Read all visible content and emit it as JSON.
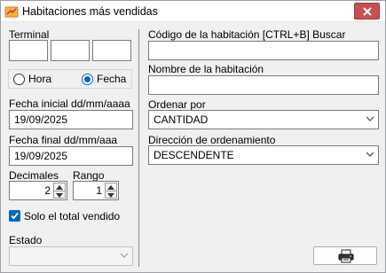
{
  "window": {
    "title": "Habitaciones más vendidas"
  },
  "terminal": {
    "label": "Terminal",
    "values": [
      "",
      "",
      ""
    ]
  },
  "mode": {
    "options": [
      "Hora",
      "Fecha"
    ],
    "selected": "Fecha"
  },
  "fecha_inicial": {
    "label": "Fecha inicial dd/mm/aaaa",
    "value": "19/09/2025"
  },
  "fecha_final": {
    "label": "Fecha final dd/mm/aaa",
    "value": "19/09/2025"
  },
  "decimales": {
    "label": "Decimales",
    "value": "2"
  },
  "rango": {
    "label": "Rango",
    "value": "1"
  },
  "solo_total": {
    "label": "Solo el total vendido",
    "checked": true
  },
  "estado": {
    "label": "Estado",
    "value": ""
  },
  "codigo": {
    "label": "Código de la habitación [CTRL+B] Buscar",
    "value": ""
  },
  "nombre": {
    "label": "Nombre de la habitación",
    "value": ""
  },
  "ordenar": {
    "label": "Ordenar por",
    "value": "CANTIDAD"
  },
  "direccion": {
    "label": "Dirección de ordenamiento",
    "value": "DESCENDENTE"
  },
  "icons": {
    "app": "report-icon",
    "close": "close-icon",
    "print": "printer-icon"
  },
  "colors": {
    "accent": "#0067c0",
    "close": "#c75050"
  }
}
